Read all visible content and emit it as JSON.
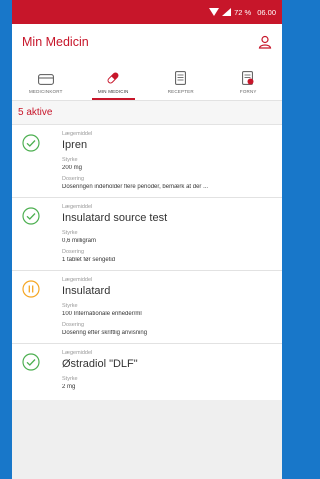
{
  "colors": {
    "brand_red": "#c7162a",
    "active_green": "#4caf50",
    "paused_orange": "#f5a623",
    "frame_blue": "#1877c9"
  },
  "statusbar": {
    "battery": "72 %",
    "time": "06.00"
  },
  "appbar": {
    "title": "Min Medicin",
    "profile_icon": "person-icon"
  },
  "tabs": [
    {
      "label": "MEDICINKORT",
      "icon": "card-icon",
      "active": false
    },
    {
      "label": "MIN MEDICIN",
      "icon": "pill-icon",
      "active": true
    },
    {
      "label": "RECEPTER",
      "icon": "document-icon",
      "active": false
    },
    {
      "label": "FORNY",
      "icon": "renew-document-icon",
      "active": false
    }
  ],
  "section": {
    "title": "5 aktive"
  },
  "medicines": [
    {
      "status": "active",
      "drug_caption": "Lægemiddel",
      "name": "Ipren",
      "strength_caption": "Styrke",
      "strength": "200 mg",
      "dosage_caption": "Dosering",
      "dosage": "Doseringen indeholder flere perioder, bemærk at der ..."
    },
    {
      "status": "active",
      "drug_caption": "Lægemiddel",
      "name": "Insulatard source test",
      "strength_caption": "Styrke",
      "strength": "0,6 milligram",
      "dosage_caption": "Dosering",
      "dosage": "1 tablet før sengetid"
    },
    {
      "status": "paused",
      "drug_caption": "Lægemiddel",
      "name": "Insulatard",
      "strength_caption": "Styrke",
      "strength": "100 Internationale enheder/ml",
      "dosage_caption": "Dosering",
      "dosage": "Dosering efter skriftlig anvisning"
    },
    {
      "status": "active",
      "drug_caption": "Lægemiddel",
      "name": "Østradiol \"DLF\"",
      "strength_caption": "Styrke",
      "strength": "2 mg",
      "dosage_caption": "",
      "dosage": ""
    }
  ]
}
